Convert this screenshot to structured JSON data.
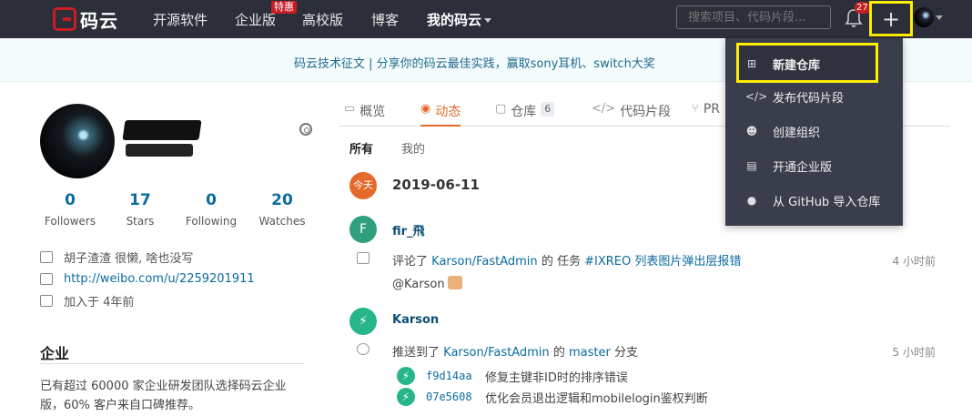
{
  "nav": {
    "logo": "码云",
    "links": [
      "开源软件",
      "企业版",
      "高校版",
      "博客",
      "我的码云"
    ],
    "special_badge": "特惠",
    "search_placeholder": "搜索项目、代码片段...",
    "notification_count": "27",
    "plus_symbol": "+"
  },
  "banner": {
    "text": "码云技术征文 | 分享你的码云最佳实践，赢取sony耳机、switch大奖"
  },
  "profile": {
    "stats": [
      {
        "num": "0",
        "label": "Followers"
      },
      {
        "num": "17",
        "label": "Stars"
      },
      {
        "num": "0",
        "label": "Following"
      },
      {
        "num": "20",
        "label": "Watches"
      }
    ],
    "bio": "胡子渣渣 很懒, 啥也没写",
    "website": "http://weibo.com/u/2259201911",
    "joined": "加入于 4年前"
  },
  "enterprise": {
    "title": "企业",
    "body": "已有超过 60000 家企业研发团队选择码云企业版，60% 客户来自口碑推荐。"
  },
  "tabs": {
    "items": [
      "概览",
      "动态",
      "仓库",
      "代码片段",
      "PR"
    ],
    "repo_count": "6"
  },
  "subtabs": [
    "所有",
    "我的"
  ],
  "feed": {
    "today": "今天",
    "date": "2019-06-11",
    "events": [
      {
        "avatar": "F",
        "user": "fir_飛",
        "prefix": "评论了",
        "repo": "Karson/FastAdmin",
        "mid": "的 任务",
        "target": "#IXREO 列表图片弹出层报错",
        "time": "4 小时前",
        "comment": "@Karson"
      },
      {
        "avatar": "⚡",
        "user": "Karson",
        "prefix": "推送到了",
        "repo": "Karson/FastAdmin",
        "mid": "的",
        "target": "master",
        "suffix": "分支",
        "time": "5 小时前"
      }
    ],
    "commits": [
      {
        "sha": "f9d14aa",
        "msg": "修复主键非ID时的排序错误"
      },
      {
        "sha": "07e5608",
        "msg": "优化会员退出逻辑和mobilelogin鉴权判断"
      }
    ]
  },
  "dropdown": {
    "items": [
      {
        "icon": "plus-square-icon",
        "label": "新建仓库"
      },
      {
        "icon": "code-icon",
        "label": "发布代码片段"
      },
      {
        "icon": "users-icon",
        "label": "创建组织"
      },
      {
        "icon": "building-icon",
        "label": "开通企业版"
      },
      {
        "icon": "github-icon",
        "label": "从 GitHub 导入仓库"
      }
    ]
  },
  "colors": {
    "nav_bg": "#2c2f3a",
    "brand_red": "#c71d23",
    "accent_orange": "#e46a2c",
    "link_blue": "#0b6ba0",
    "highlight_yellow": "#ffee00",
    "commit_green": "#27b58a"
  }
}
